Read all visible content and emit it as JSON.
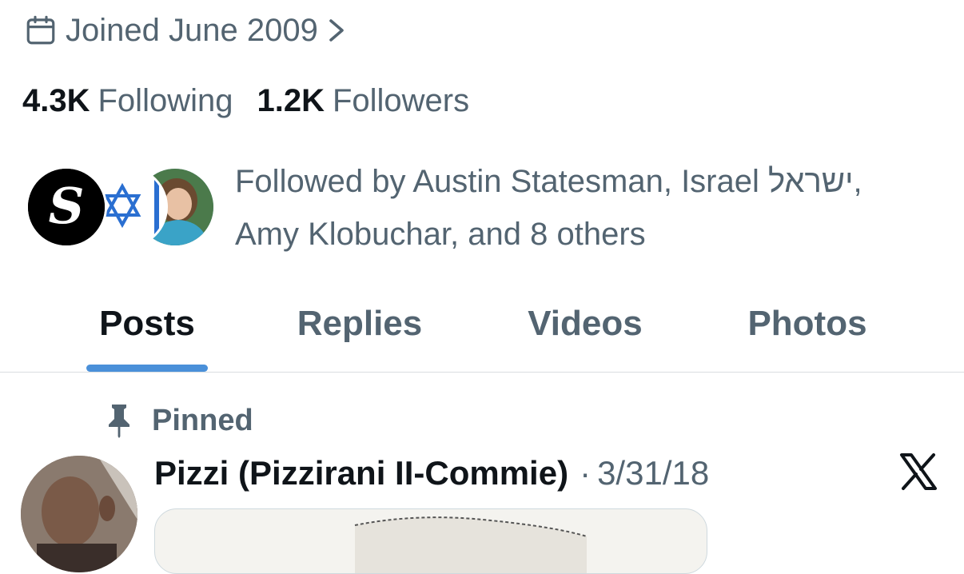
{
  "profile": {
    "joined_text": "Joined June 2009",
    "following_count": "4.3K",
    "following_label": "Following",
    "followers_count": "1.2K",
    "followers_label": "Followers",
    "followed_by_line1": "Followed by Austin Statesman, Israel ישראל,",
    "followed_by_line2": "Amy Klobuchar, and 8 others"
  },
  "tabs": [
    {
      "label": "Posts",
      "active": true
    },
    {
      "label": "Replies",
      "active": false
    },
    {
      "label": "Videos",
      "active": false
    },
    {
      "label": "Photos",
      "active": false
    }
  ],
  "post": {
    "pinned_label": "Pinned",
    "author": "Pizzi (Pizzirani II-Commie)",
    "separator": "·",
    "date": "3/31/18"
  },
  "colors": {
    "accent": "#4a90d9",
    "text_primary": "#0f1419",
    "text_secondary": "#536471",
    "divider": "#d9dde1"
  },
  "icons": {
    "joined": "calendar-icon",
    "joined_chevron": "chevron-right-icon",
    "pinned": "pin-icon",
    "brand": "x-logo-icon"
  }
}
